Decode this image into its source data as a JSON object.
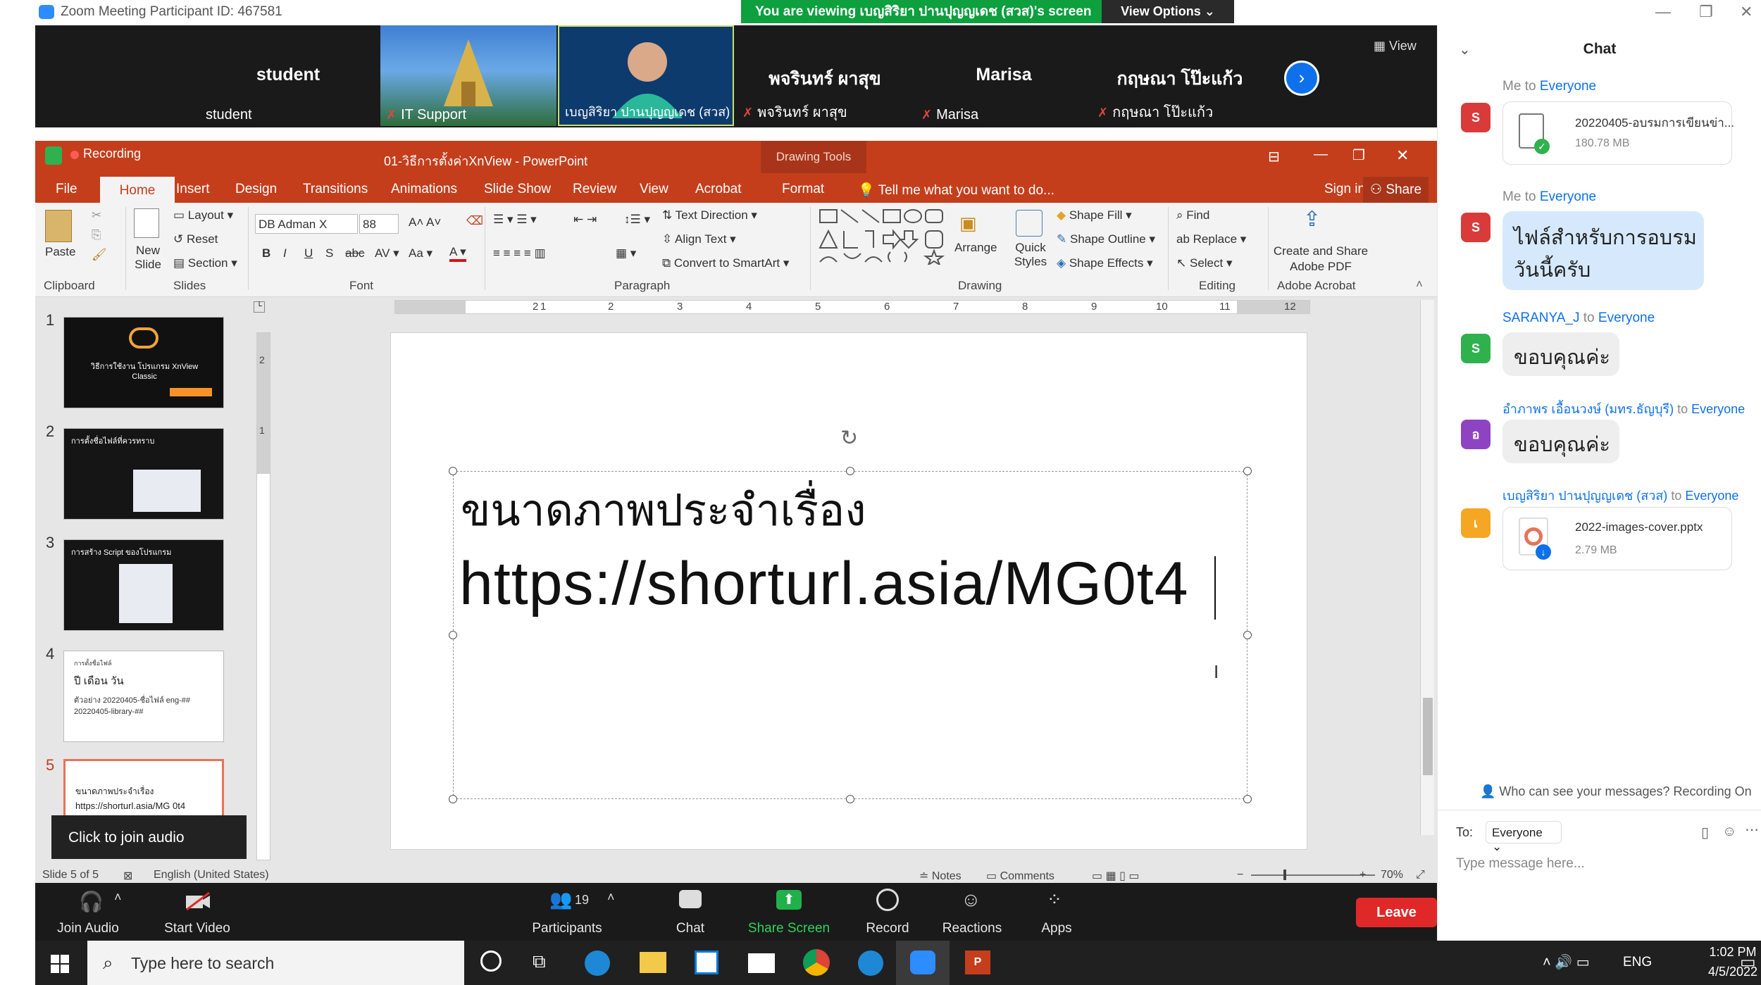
{
  "window": {
    "title": "Zoom Meeting Participant ID: 467581",
    "banner": "You are viewing เบญสิริยา ปานปุญญเดช (สวส)'s screen",
    "view_options": "View Options"
  },
  "gallery": {
    "view_label": "View",
    "tiles": [
      {
        "name": "student",
        "label": "student"
      },
      {
        "name": "",
        "label": "IT Support"
      },
      {
        "name": "",
        "label": "เบญสิริยา ปานปุญญเดช (สวส)"
      },
      {
        "name": "พจรินทร์ ผาสุข",
        "label": "พจรินทร์ ผาสุข"
      },
      {
        "name": "Marisa",
        "label": "Marisa"
      },
      {
        "name": "กฤษณา โป๊ะแก้ว",
        "label": "กฤษณา โป๊ะแก้ว"
      }
    ]
  },
  "ppt": {
    "recording": "Recording",
    "doc_title": "01-วิธีการตั้งค่าXnView - PowerPoint",
    "drawing_tools": "Drawing Tools",
    "tabs": [
      "File",
      "Home",
      "Insert",
      "Design",
      "Transitions",
      "Animations",
      "Slide Show",
      "Review",
      "View",
      "Acrobat",
      "Format"
    ],
    "tell_me": "Tell me what you want to do...",
    "sign_in": "Sign in",
    "share": "Share",
    "ribbon": {
      "paste": "Paste",
      "new_slide": "New Slide",
      "layout": "Layout",
      "reset": "Reset",
      "section": "Section",
      "font_name": "DB Adman X",
      "font_size": "88",
      "text_direction": "Text Direction",
      "align_text": "Align Text",
      "convert_smartart": "Convert to SmartArt",
      "arrange": "Arrange",
      "quick_styles": "Quick Styles",
      "shape_fill": "Shape Fill",
      "shape_outline": "Shape Outline",
      "shape_effects": "Shape Effects",
      "find": "Find",
      "replace": "Replace",
      "select": "Select",
      "create_pdf": "Create and Share Adobe PDF"
    },
    "groups": [
      "Clipboard",
      "Slides",
      "Font",
      "Paragraph",
      "Drawing",
      "Editing",
      "Adobe Acrobat"
    ],
    "ruler_numbers": [
      "2",
      "1",
      "1",
      "2",
      "3",
      "4",
      "5",
      "6",
      "7",
      "8",
      "9",
      "10",
      "11",
      "12"
    ],
    "thumbs": [
      {
        "num": "1",
        "text": "วิธีการใช้งาน โปรแกรม XnView Classic"
      },
      {
        "num": "2",
        "text": "การตั้งชื่อไฟล์ที่ควรทราบ"
      },
      {
        "num": "3",
        "text": "การสร้าง Script ของโปรแกรม"
      },
      {
        "num": "4",
        "line1": "การตั้งชื่อไฟล์",
        "line2": "ปี เดือน วัน",
        "line3": "ตัวอย่าง 20220405-ชื่อไฟล์ eng-##",
        "line4": "20220405-library-##"
      },
      {
        "num": "5",
        "line1": "ขนาดภาพประจำเรื่อง",
        "line2": "https://shorturl.asia/MG 0t4"
      }
    ],
    "slide": {
      "heading": "ขนาดภาพประจำเรื่อง",
      "url": "https://shorturl.asia/MG0t4"
    },
    "status": {
      "slide_of": "Slide 5 of 5",
      "language": "English (United States)",
      "notes": "Notes",
      "comments": "Comments",
      "zoom": "70%"
    }
  },
  "zoom_toolbar": {
    "join_audio": "Join Audio",
    "start_video": "Start Video",
    "participants": "Participants",
    "participants_count": "19",
    "chat": "Chat",
    "share_screen": "Share Screen",
    "record": "Record",
    "reactions": "Reactions",
    "apps": "Apps",
    "leave": "Leave",
    "audio_tip": "Click to join audio"
  },
  "taskbar": {
    "search_placeholder": "Type here to search",
    "lang": "ENG",
    "time": "1:02 PM",
    "date": "4/5/2022"
  },
  "chat": {
    "title": "Chat",
    "to": "to",
    "messages": [
      {
        "sender": "Me",
        "recipient": "Everyone",
        "avatar": "S",
        "avatar_color": "#d93b3b",
        "file_name": "20220405-อบรมการเขียนข่า...",
        "file_size": "180.78 MB"
      },
      {
        "sender": "Me",
        "recipient": "Everyone",
        "avatar": "S",
        "avatar_color": "#d93b3b",
        "line1": "ไฟล์สำหรับการอบรม",
        "line2": "วันนี้ครับ"
      },
      {
        "sender": "SARANYA_J",
        "recipient": "Everyone",
        "avatar": "S",
        "avatar_color": "#2fb14e",
        "text": "ขอบคุณค่ะ"
      },
      {
        "sender": "อำภาพร เอื้อนวงษ์ (มทร.ธัญบุรี)",
        "recipient": "Everyone",
        "avatar": "อ",
        "avatar_color": "#8e44c2",
        "text": "ขอบคุณค่ะ"
      },
      {
        "sender": "เบญสิริยา ปานปุญญเดช (สวส)",
        "recipient": "Everyone",
        "avatar": "เ",
        "avatar_color": "#f5a623",
        "file_name": "2022-images-cover.pptx",
        "file_size": "2.79 MB"
      }
    ],
    "who_can_see": "Who can see your messages? Recording On",
    "to_label": "To:",
    "to_value": "Everyone",
    "placeholder": "Type message here..."
  }
}
